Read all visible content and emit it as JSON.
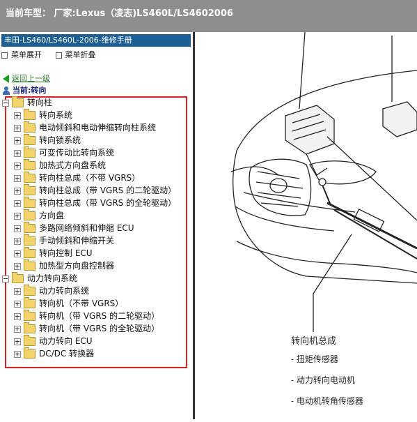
{
  "topbar": {
    "title": "当前车型： 厂家:Lexus（凌志)LS460L/LS4602006"
  },
  "left_panel": {
    "manual_title": "丰田-LS460/LS460L-2006-维修手册",
    "menu": {
      "expand": "菜单展开",
      "collapse": "菜单折叠"
    },
    "back_link": "返回上一级",
    "current": "当前:转向",
    "tree": [
      {
        "label": "转向柱",
        "level": 0,
        "expanded": true
      },
      {
        "label": "转向系统",
        "level": 1
      },
      {
        "label": "电动倾斜和电动伸缩转向柱系统",
        "level": 1
      },
      {
        "label": "转向锁系统",
        "level": 1
      },
      {
        "label": "可变传动比转向系统",
        "level": 1
      },
      {
        "label": "加热式方向盘系统",
        "level": 1
      },
      {
        "label": "转向柱总成（不带 VGRS）",
        "level": 1
      },
      {
        "label": "转向柱总成（带 VGRS 的二轮驱动）",
        "level": 1
      },
      {
        "label": "转向柱总成（带 VGRS 的全轮驱动）",
        "level": 1
      },
      {
        "label": "方向盘",
        "level": 1
      },
      {
        "label": "多路网络倾斜和伸缩 ECU",
        "level": 1
      },
      {
        "label": "手动倾斜和伸缩开关",
        "level": 1
      },
      {
        "label": "转向控制 ECU",
        "level": 1
      },
      {
        "label": "加热型方向盘控制器",
        "level": 1
      },
      {
        "label": "动力转向系统",
        "level": 0,
        "expanded": true
      },
      {
        "label": "动力转向系统",
        "level": 1
      },
      {
        "label": "转向机（不带 VGRS）",
        "level": 1
      },
      {
        "label": "转向机（带 VGRS 的二轮驱动）",
        "level": 1
      },
      {
        "label": "转向机（带 VGRS 的全轮驱动）",
        "level": 1
      },
      {
        "label": "动力转向 ECU",
        "level": 1
      },
      {
        "label": "DC/DC 转换器",
        "level": 1
      }
    ]
  },
  "diagram": {
    "title": "转向机总成",
    "items": [
      "- 扭矩传感器",
      "- 动力转向电动机",
      "- 电动机转角传感器"
    ]
  },
  "colors": {
    "topbar": "#8e8e8e",
    "header": "#1c5f95",
    "highlight_box": "#e02020",
    "back_link": "#2a7a2a"
  }
}
